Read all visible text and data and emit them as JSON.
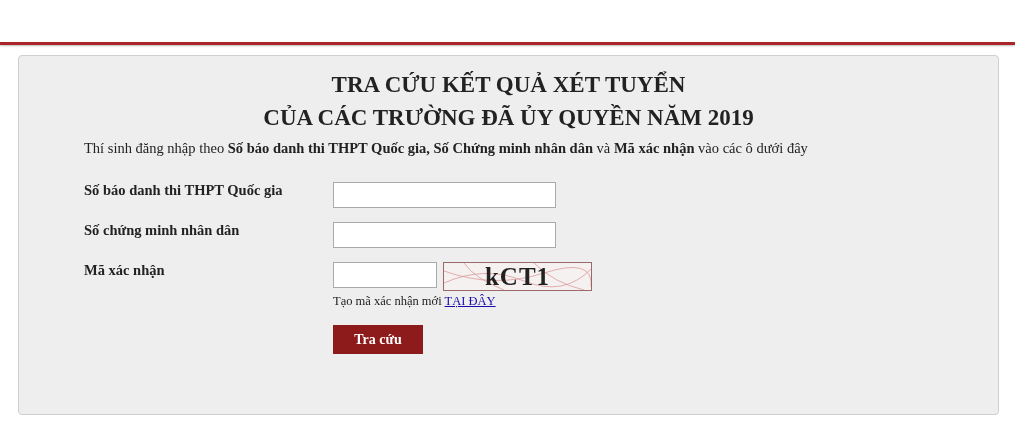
{
  "title_lines": [
    "TRA CỨU KẾT QUẢ XÉT TUYỂN",
    "CỦA CÁC TRƯỜNG ĐÃ ỦY QUYỀN NĂM 2019"
  ],
  "intro": "Thí sinh đăng nhập theo **Số báo danh thi THPT Quốc gia, Số Chứng minh nhân dân** và **Mã xác nhận** vào các ô dưới đây",
  "fields": [
    {
      "kind": "text",
      "label": "Số báo danh thi THPT Quốc gia"
    },
    {
      "kind": "text",
      "label": "Số chứng minh nhân dân"
    },
    {
      "kind": "captcha",
      "label": "Mã xác nhận",
      "captcha": "kCT1",
      "hint": "Tạo mã xác nhận mới",
      "link": "TẠI ĐÂY"
    }
  ],
  "submit": "Tra cứu"
}
